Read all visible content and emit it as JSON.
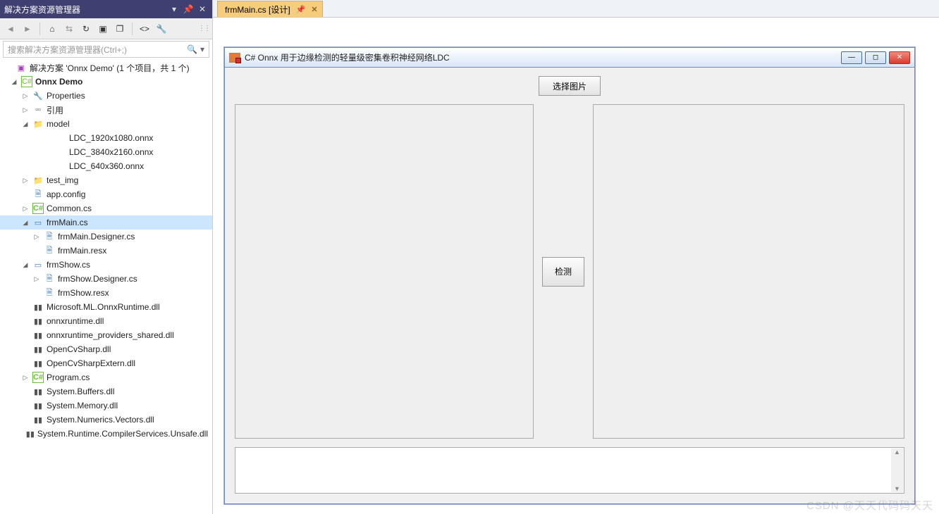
{
  "sx": {
    "title": "解决方案资源管理器",
    "search_placeholder": "搜索解决方案资源管理器(Ctrl+;)",
    "toolbar_icons": [
      "back",
      "fwd",
      "home",
      "sync",
      "refresh",
      "collapse",
      "newwin",
      "showall",
      "props",
      "wrench"
    ]
  },
  "tree": {
    "solution": "解决方案 'Onnx Demo' (1 个项目，共 1 个)",
    "project": "Onnx Demo",
    "properties": "Properties",
    "references": "引用",
    "folders": {
      "model": "model",
      "model_items": [
        "LDC_1920x1080.onnx",
        "LDC_3840x2160.onnx",
        "LDC_640x360.onnx"
      ],
      "test_img": "test_img"
    },
    "appconfig": "app.config",
    "common": "Common.cs",
    "frmMain": "frmMain.cs",
    "frmMain_children": [
      "frmMain.Designer.cs",
      "frmMain.resx"
    ],
    "frmShow": "frmShow.cs",
    "frmShow_children": [
      "frmShow.Designer.cs",
      "frmShow.resx"
    ],
    "dlls": [
      "Microsoft.ML.OnnxRuntime.dll",
      "onnxruntime.dll",
      "onnxruntime_providers_shared.dll",
      "OpenCvSharp.dll",
      "OpenCvSharpExtern.dll"
    ],
    "program": "Program.cs",
    "dlls2": [
      "System.Buffers.dll",
      "System.Memory.dll",
      "System.Numerics.Vectors.dll",
      "System.Runtime.CompilerServices.Unsafe.dll"
    ]
  },
  "tab": {
    "label": "frmMain.cs [设计]"
  },
  "form": {
    "title": "C# Onnx 用于边缘检测的轻量级密集卷积神经网络LDC",
    "btn_select": "选择图片",
    "btn_detect": "检测"
  },
  "watermark": "CSDN @天天代码码天天"
}
